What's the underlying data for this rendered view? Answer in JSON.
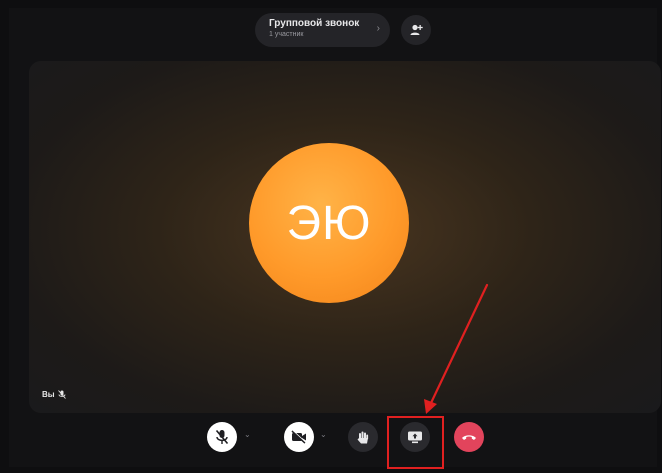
{
  "header": {
    "title": "Групповой звонок",
    "subtitle": "1 участник"
  },
  "stage": {
    "avatar_initials": "ЭЮ",
    "avatar_color": "#ff9a2a",
    "self_label": "Вы"
  },
  "controls": [
    {
      "name": "microphone-muted",
      "icon": "mic-off-icon",
      "style": "white"
    },
    {
      "name": "camera-off",
      "icon": "camera-off-icon",
      "style": "white"
    },
    {
      "name": "raise-hand",
      "icon": "hand-icon",
      "style": "dark"
    },
    {
      "name": "share-screen",
      "icon": "screen-share-icon",
      "style": "dark",
      "highlighted": true
    },
    {
      "name": "end-call",
      "icon": "hang-up-icon",
      "style": "red",
      "color": "#e2445c"
    }
  ],
  "annotation": {
    "arrow_color": "#e02020",
    "box_color": "#e02020"
  }
}
